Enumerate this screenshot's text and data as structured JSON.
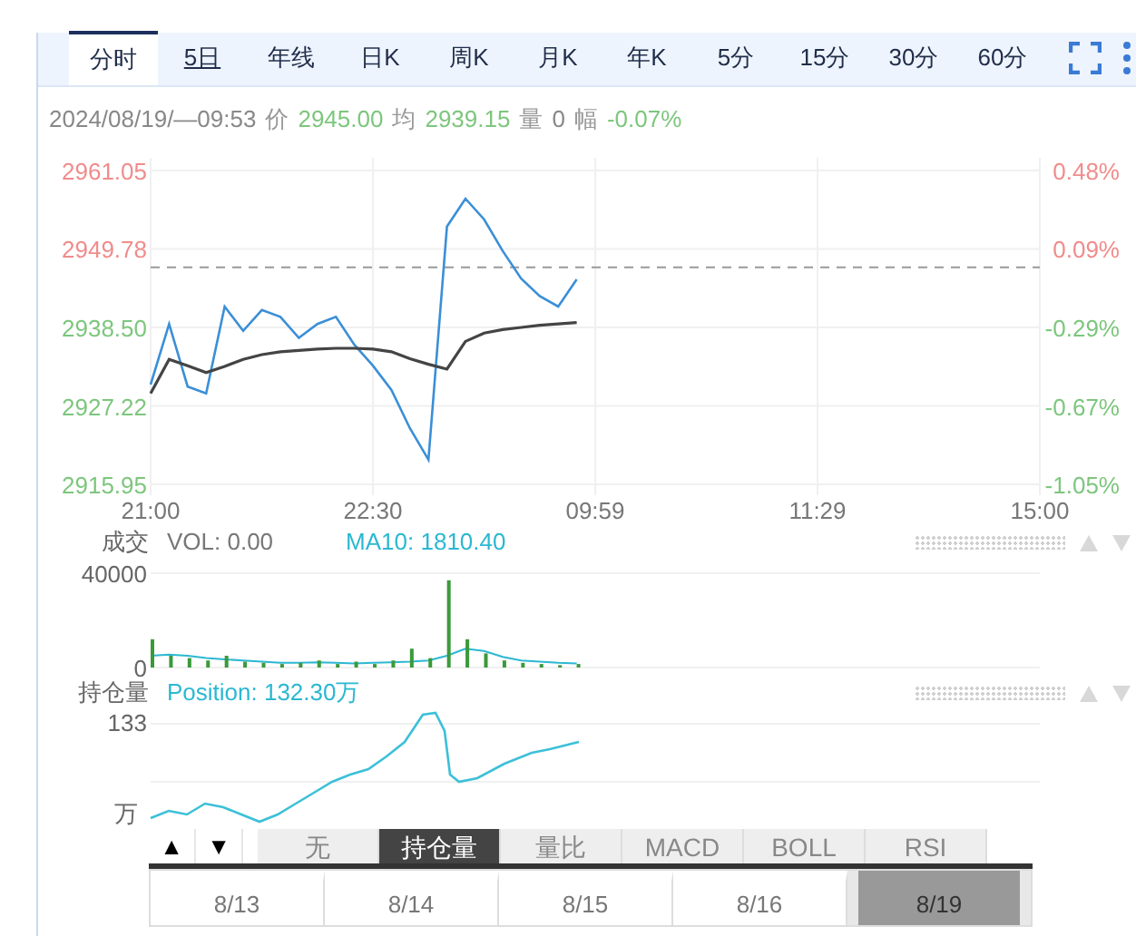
{
  "period_tabs": [
    {
      "label": "分时",
      "selected": true,
      "underlined": false
    },
    {
      "label": "5日",
      "selected": false,
      "underlined": true
    },
    {
      "label": "年线",
      "selected": false,
      "underlined": false
    },
    {
      "label": "日K",
      "selected": false,
      "underlined": false
    },
    {
      "label": "周K",
      "selected": false,
      "underlined": false
    },
    {
      "label": "月K",
      "selected": false,
      "underlined": false
    },
    {
      "label": "年K",
      "selected": false,
      "underlined": false
    },
    {
      "label": "5分",
      "selected": false,
      "underlined": false
    },
    {
      "label": "15分",
      "selected": false,
      "underlined": false
    },
    {
      "label": "30分",
      "selected": false,
      "underlined": false
    },
    {
      "label": "60分",
      "selected": false,
      "underlined": false
    }
  ],
  "info_bar": {
    "datetime": "2024/08/19/—09:53",
    "items": [
      {
        "label": "价",
        "value": "2945.00",
        "color": "#7dc67d"
      },
      {
        "label": "均",
        "value": "2939.15",
        "color": "#7dc67d"
      },
      {
        "label": "量",
        "value": "0",
        "color": "#888888"
      },
      {
        "label": "幅",
        "value": "-0.07%",
        "color": "#7dc67d"
      }
    ]
  },
  "price_chart": {
    "right_axis_labels": [
      {
        "label": "0.48%",
        "color": "#f08c8c"
      },
      {
        "label": "0.09%",
        "color": "#f08c8c"
      },
      {
        "label": "-0.29%",
        "color": "#7dc67d"
      },
      {
        "label": "-0.67%",
        "color": "#7dc67d"
      },
      {
        "label": "-1.05%",
        "color": "#7dc67d"
      }
    ],
    "chart_data": {
      "type": "line",
      "grid": true,
      "ylim": [
        2915.95,
        2961.05
      ],
      "categories": [
        "21:00",
        null,
        null,
        null,
        null,
        null,
        null,
        null,
        null,
        null,
        null,
        null,
        "22:30",
        null,
        null,
        null,
        null,
        null,
        null,
        null,
        null,
        null,
        null,
        null,
        "09:59",
        null,
        null,
        null,
        null,
        null,
        null,
        null,
        null,
        null,
        null,
        null,
        "11:29",
        null,
        null,
        null,
        null,
        null,
        null,
        null,
        null,
        null,
        null,
        null,
        "15:00"
      ],
      "yticks": [
        {
          "value": 2961.05,
          "label": "2961.05"
        },
        {
          "value": 2949.78,
          "label": "2949.78"
        },
        {
          "value": 2938.5,
          "label": "2938.50"
        },
        {
          "value": 2927.22,
          "label": "2927.22"
        },
        {
          "value": 2915.95,
          "label": "2915.95"
        }
      ],
      "series": [
        {
          "color": "#3b8fd6",
          "values": [
            2930.3,
            2939.0,
            2930.0,
            2929.0,
            2941.5,
            2938.0,
            2941.0,
            2940.0,
            2937.0,
            2939.0,
            2940.0,
            2936.0,
            2933.0,
            2929.5,
            2924.0,
            2919.5,
            2953.0,
            2957.0,
            2954.0,
            2949.5,
            2945.5,
            2943.0,
            2941.5,
            2945.4,
            null,
            null,
            null,
            null,
            null,
            null,
            null,
            null,
            null,
            null,
            null,
            null,
            null,
            null,
            null,
            null,
            null,
            null,
            null,
            null,
            null,
            null,
            null,
            null,
            null
          ]
        },
        {
          "color": "#444444",
          "values": [
            2929.0,
            2933.9,
            2933.0,
            2932.0,
            2932.9,
            2933.9,
            2934.6,
            2935.0,
            2935.2,
            2935.4,
            2935.5,
            2935.5,
            2935.4,
            2935.0,
            2934.0,
            2933.2,
            2932.5,
            2936.5,
            2937.7,
            2938.2,
            2938.5,
            2938.8,
            2939.0,
            2939.2,
            null,
            null,
            null,
            null,
            null,
            null,
            null,
            null,
            null,
            null,
            null,
            null,
            null,
            null,
            null,
            null,
            null,
            null,
            null,
            null,
            null,
            null,
            null,
            null,
            null
          ]
        }
      ],
      "ref_lines": [
        {
          "axis": "y",
          "value": 2947.13
        }
      ]
    }
  },
  "volume_panel": {
    "title": "成交",
    "vol": "VOL: 0.00",
    "ma": "MA10: 1810.40",
    "chart_data": {
      "type": "bar",
      "grid": true,
      "ylim": [
        0,
        40000
      ],
      "yticks": [
        {
          "value": 40000,
          "label": "40000"
        },
        {
          "value": 0,
          "label": "0"
        }
      ],
      "series": [
        {
          "type": "bar",
          "color": "#3a9a3a",
          "values": [
            12000,
            5000,
            4000,
            3000,
            5000,
            2500,
            2000,
            1500,
            2000,
            3000,
            1500,
            2500,
            1500,
            3000,
            8000,
            4000,
            37000,
            12000,
            6000,
            3000,
            2000,
            1500,
            1000,
            1500,
            null,
            null,
            null,
            null,
            null,
            null,
            null,
            null,
            null,
            null,
            null,
            null,
            null,
            null,
            null,
            null,
            null,
            null,
            null,
            null,
            null,
            null,
            null,
            null,
            null
          ]
        },
        {
          "type": "line",
          "color": "#2bb8d2",
          "values": [
            5000,
            5500,
            5000,
            4000,
            3500,
            3000,
            2500,
            2000,
            2000,
            2200,
            2000,
            1800,
            2000,
            2200,
            2500,
            3000,
            5000,
            8000,
            7000,
            4500,
            3000,
            2500,
            2000,
            1800,
            null,
            null,
            null,
            null,
            null,
            null,
            null,
            null,
            null,
            null,
            null,
            null,
            null,
            null,
            null,
            null,
            null,
            null,
            null,
            null,
            null,
            null,
            null,
            null,
            null
          ]
        }
      ]
    }
  },
  "position_panel": {
    "title": "持仓量",
    "position": "Position: 132.30万",
    "axis_labels": [
      "133",
      "万"
    ]
  },
  "indicator_buttons": [
    "▲",
    "▼"
  ],
  "indicator_tabs": [
    {
      "label": "无",
      "selected": false
    },
    {
      "label": "持仓量",
      "selected": true
    },
    {
      "label": "量比",
      "selected": false
    },
    {
      "label": "MACD",
      "selected": false
    },
    {
      "label": "BOLL",
      "selected": false
    },
    {
      "label": "RSI",
      "selected": false
    }
  ],
  "navigator": [
    {
      "label": "8/13",
      "selected": false
    },
    {
      "label": "8/14",
      "selected": false
    },
    {
      "label": "8/15",
      "selected": false
    },
    {
      "label": "8/16",
      "selected": false
    },
    {
      "label": "8/19",
      "selected": true
    }
  ]
}
